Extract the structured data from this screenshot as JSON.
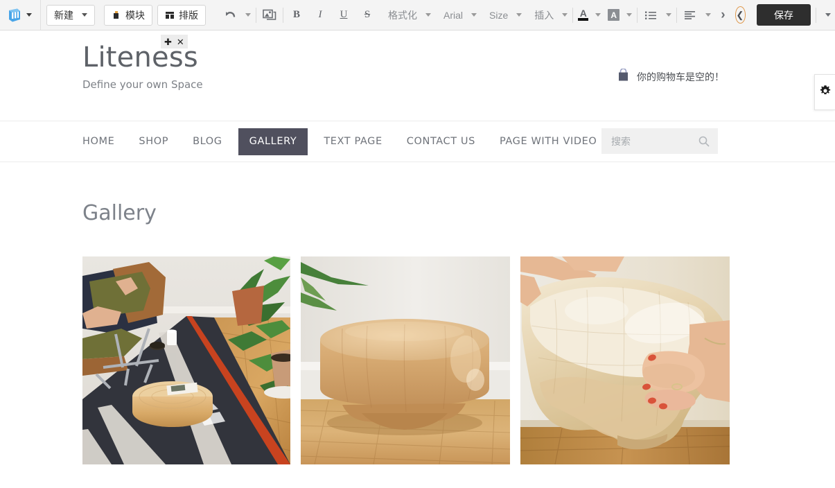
{
  "toolbar": {
    "logo_icon": "app-logo-icon",
    "logo_caret": "chevron-down-icon",
    "new_button": {
      "label": "新建",
      "caret": "chevron-down-icon"
    },
    "modules_button": {
      "label": "模块",
      "icon": "modules-icon"
    },
    "layout_button": {
      "label": "排版",
      "icon": "layout-icon"
    },
    "undo": {
      "icon": "undo-icon",
      "caret": "chevron-down-icon"
    },
    "image": {
      "icon": "image-icon"
    },
    "bold": {
      "label": "B",
      "icon": "bold-icon"
    },
    "italic": {
      "label": "I",
      "icon": "italic-icon"
    },
    "underline": {
      "label": "U",
      "icon": "underline-icon"
    },
    "strikethrough": {
      "label": "S",
      "icon": "strikethrough-icon"
    },
    "format": {
      "label": "格式化",
      "caret": "chevron-down-icon"
    },
    "font_family": {
      "label": "Arial",
      "caret": "chevron-down-icon"
    },
    "font_size": {
      "label": "Size",
      "caret": "chevron-down-icon"
    },
    "insert": {
      "label": "插入",
      "caret": "chevron-down-icon"
    },
    "font_color": {
      "label": "A",
      "caret": "chevron-down-icon",
      "swatch": "#111111"
    },
    "highlight_color": {
      "label": "A",
      "caret": "chevron-down-icon",
      "swatch": "#8b8e93"
    },
    "list": {
      "icon": "bulleted-list-icon",
      "caret": "chevron-down-icon"
    },
    "align": {
      "icon": "align-left-icon",
      "caret": "chevron-down-icon"
    },
    "more": {
      "icon": "chevron-right-icon"
    },
    "history": {
      "icon": "history-clock-icon",
      "ring_color": "#e09a4e"
    },
    "save_button": {
      "label": "保存"
    },
    "overflow": {
      "icon": "chevron-down-icon"
    }
  },
  "site": {
    "brand": {
      "title": "Liteness",
      "tagline": "Define your own Space"
    },
    "element_controls": {
      "move_icon": "move-icon",
      "close_icon": "close-icon"
    },
    "cart": {
      "icon": "shopping-bag-icon",
      "text": "你的购物车是空的！"
    },
    "nav": {
      "items": [
        {
          "label": "HOME",
          "active": false
        },
        {
          "label": "SHOP",
          "active": false
        },
        {
          "label": "BLOG",
          "active": false
        },
        {
          "label": "GALLERY",
          "active": true
        },
        {
          "label": "TEXT PAGE",
          "active": false
        },
        {
          "label": "CONTACT US",
          "active": false
        },
        {
          "label": "PAGE WITH VIDEO",
          "active": false
        }
      ],
      "active_bg": "#50505e",
      "search": {
        "value": "",
        "placeholder": "搜索",
        "icon": "search-icon"
      }
    },
    "page": {
      "title": "Gallery",
      "gallery": [
        {
          "alt": "woman-in-lounge-chair-with-round-wooden-stool",
          "id": "gallery-image-1"
        },
        {
          "alt": "round-wooden-stool-on-parquet-floor",
          "id": "gallery-image-2"
        },
        {
          "alt": "hands-holding-organic-wooden-sculpture",
          "id": "gallery-image-3"
        }
      ]
    },
    "settings_tab": {
      "icon": "gear-icon"
    }
  }
}
